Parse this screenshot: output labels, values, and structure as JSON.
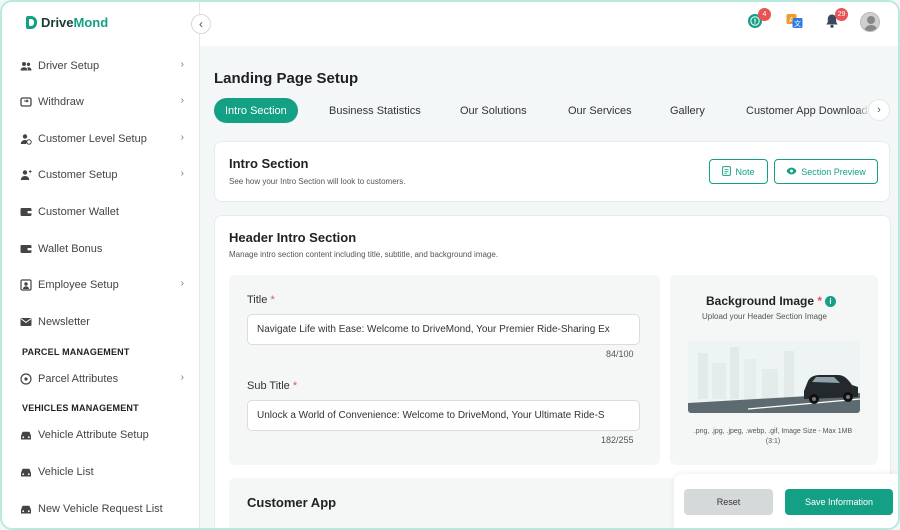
{
  "brand": {
    "name_prefix": "Drive",
    "name_suffix": "Mond"
  },
  "sidebar": {
    "items": [
      {
        "label": "Driver Setup",
        "icon": "users-icon",
        "has_chevron": true
      },
      {
        "label": "Withdraw",
        "icon": "wallet-swap-icon",
        "has_chevron": true
      },
      {
        "label": "Customer Level Setup",
        "icon": "user-level-icon",
        "has_chevron": true
      },
      {
        "label": "Customer Setup",
        "icon": "user-gear-icon",
        "has_chevron": true
      },
      {
        "label": "Customer Wallet",
        "icon": "wallet-icon",
        "has_chevron": false
      },
      {
        "label": "Wallet Bonus",
        "icon": "wallet-bonus-icon",
        "has_chevron": false
      },
      {
        "label": "Employee Setup",
        "icon": "id-card-icon",
        "has_chevron": true
      },
      {
        "label": "Newsletter",
        "icon": "mail-icon",
        "has_chevron": false
      },
      {
        "label": "Parcel Attributes",
        "icon": "parcel-icon",
        "has_chevron": true
      },
      {
        "label": "Vehicle Attribute Setup",
        "icon": "car-gear-icon",
        "has_chevron": false
      },
      {
        "label": "Vehicle List",
        "icon": "car-icon",
        "has_chevron": false
      },
      {
        "label": "New Vehicle Request List",
        "icon": "car-request-icon",
        "has_chevron": false
      }
    ],
    "sections": {
      "parcel": "PARCEL MANAGEMENT",
      "vehicles": "VEHICLES MANAGEMENT"
    }
  },
  "topbar": {
    "notification_badge_1": "4",
    "notification_badge_2": "29",
    "icons": [
      "alert-icon",
      "translate-icon",
      "bell-icon",
      "avatar"
    ]
  },
  "page": {
    "title": "Landing Page Setup",
    "tabs": [
      "Intro Section",
      "Business Statistics",
      "Our Solutions",
      "Our Services",
      "Gallery",
      "Customer App Download"
    ],
    "active_tab": "Intro Section"
  },
  "intro_card": {
    "title": "Intro Section",
    "subtitle": "See how your Intro Section will look to customers.",
    "note_label": "Note",
    "preview_label": "Section Preview"
  },
  "header_card": {
    "title": "Header Intro Section",
    "subtitle": "Manage intro section content including title, subtitle, and background image.",
    "title_label": "Title",
    "title_value": "Navigate Life with Ease: Welcome to DriveMond, Your Premier Ride-Sharing Ex",
    "title_counter": "84/100",
    "subtitle_label": "Sub Title",
    "subtitle_value": "Unlock a World of Convenience: Welcome to DriveMond, Your Ultimate Ride-S",
    "subtitle_counter": "182/255",
    "required_mark": "*"
  },
  "bg_image": {
    "title": "Background Image",
    "subtitle": "Upload your Header Section Image",
    "hint_line1": ".png, .jpg, .jpeg, .webp, .gif, Image Size - Max 1MB",
    "hint_line2": "(3:1)"
  },
  "customer_app": {
    "title": "Customer App"
  },
  "footer": {
    "reset_label": "Reset",
    "save_label": "Save Information"
  },
  "colors": {
    "accent": "#14a085",
    "badge": "#e75454",
    "text": "#333333"
  }
}
